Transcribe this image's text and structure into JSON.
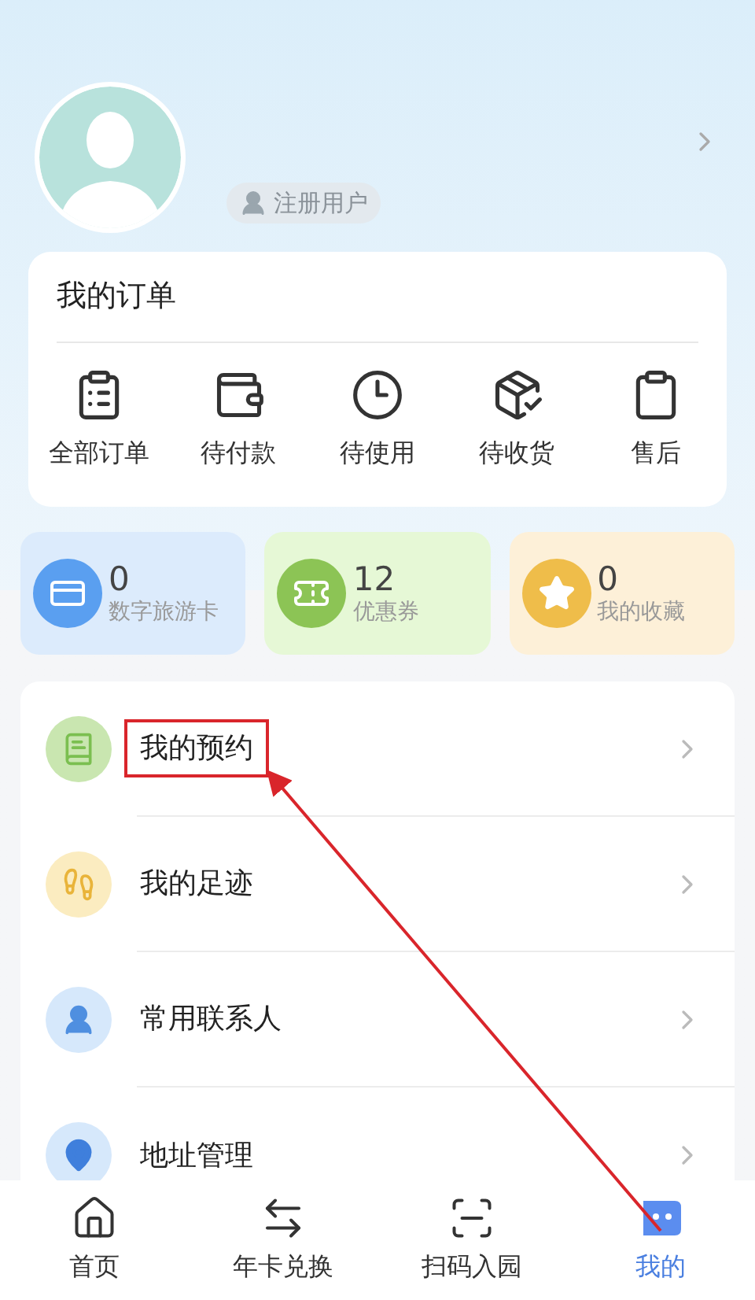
{
  "profile": {
    "badge": "注册用户"
  },
  "orders": {
    "title": "我的订单",
    "items": [
      {
        "label": "全部订单",
        "kind": "list"
      },
      {
        "label": "待付款",
        "kind": "pay"
      },
      {
        "label": "待使用",
        "kind": "clock"
      },
      {
        "label": "待收货",
        "kind": "box"
      },
      {
        "label": "售后",
        "kind": "return"
      }
    ]
  },
  "stats": [
    {
      "count": "0",
      "label": "数字旅游卡",
      "kind": "card",
      "color": "#5a9ff0"
    },
    {
      "count": "12",
      "label": "优惠券",
      "kind": "ticket",
      "color": "#8cc455"
    },
    {
      "count": "0",
      "label": "我的收藏",
      "kind": "star",
      "color": "#efbd4a"
    }
  ],
  "menu": [
    {
      "label": "我的预约",
      "kind": "booking",
      "highlighted": true
    },
    {
      "label": "我的足迹",
      "kind": "footprint",
      "highlighted": false
    },
    {
      "label": "常用联系人",
      "kind": "contacts",
      "highlighted": false
    },
    {
      "label": "地址管理",
      "kind": "address",
      "highlighted": false
    }
  ],
  "tabs": [
    {
      "label": "首页",
      "kind": "home",
      "selected": false
    },
    {
      "label": "年卡兑换",
      "kind": "exchange",
      "selected": false
    },
    {
      "label": "扫码入园",
      "kind": "scan",
      "selected": false
    },
    {
      "label": "我的",
      "kind": "me",
      "selected": true
    }
  ]
}
